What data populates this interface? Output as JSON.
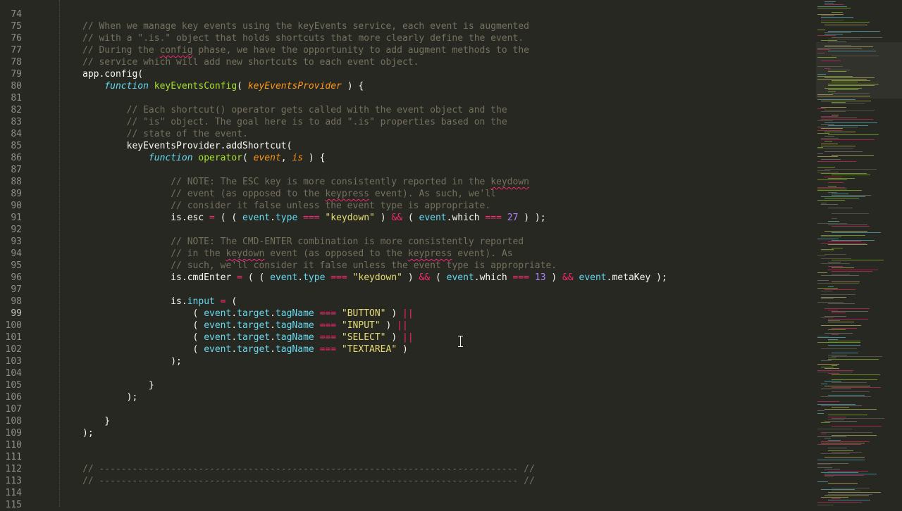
{
  "editor": {
    "active_line": 99,
    "lines": [
      {
        "n": 74,
        "segs": []
      },
      {
        "n": 75,
        "segs": [
          {
            "t": "// When we manage key events using the keyEvents service, each event is augmented",
            "c": "c-comment"
          }
        ]
      },
      {
        "n": 76,
        "segs": [
          {
            "t": "// with a \".is.\" object that holds shortcuts that more clearly define the event.",
            "c": "c-comment"
          }
        ]
      },
      {
        "n": 77,
        "segs": [
          {
            "t": "// During the ",
            "c": "c-comment"
          },
          {
            "t": "config",
            "c": "c-comment squig"
          },
          {
            "t": " phase, we have the opportunity to add augment methods to the",
            "c": "c-comment"
          }
        ]
      },
      {
        "n": 78,
        "segs": [
          {
            "t": "// service which will add new shortcuts to each event object.",
            "c": "c-comment"
          }
        ]
      },
      {
        "n": 79,
        "segs": [
          {
            "t": "app.config(",
            "c": "c-plain"
          }
        ]
      },
      {
        "n": 80,
        "segs": [
          {
            "t": "    ",
            "c": "c-plain"
          },
          {
            "t": "function",
            "c": "c-kw"
          },
          {
            "t": " ",
            "c": "c-plain"
          },
          {
            "t": "keyEventsConfig",
            "c": "c-fn"
          },
          {
            "t": "( ",
            "c": "c-plain"
          },
          {
            "t": "keyEventsProvider",
            "c": "c-param"
          },
          {
            "t": " ) {",
            "c": "c-plain"
          }
        ]
      },
      {
        "n": 81,
        "segs": []
      },
      {
        "n": 82,
        "segs": [
          {
            "t": "        // Each shortcut() operator gets called with the event object and the",
            "c": "c-comment"
          }
        ]
      },
      {
        "n": 83,
        "segs": [
          {
            "t": "        // \"is\" object. The goal here is to add \".is\" properties based on the",
            "c": "c-comment"
          }
        ]
      },
      {
        "n": 84,
        "segs": [
          {
            "t": "        // state of the event.",
            "c": "c-comment"
          }
        ]
      },
      {
        "n": 85,
        "segs": [
          {
            "t": "        keyEventsProvider.addShortcut(",
            "c": "c-plain"
          }
        ]
      },
      {
        "n": 86,
        "segs": [
          {
            "t": "            ",
            "c": "c-plain"
          },
          {
            "t": "function",
            "c": "c-kw"
          },
          {
            "t": " ",
            "c": "c-plain"
          },
          {
            "t": "operator",
            "c": "c-fn"
          },
          {
            "t": "( ",
            "c": "c-plain"
          },
          {
            "t": "event",
            "c": "c-param"
          },
          {
            "t": ", ",
            "c": "c-plain"
          },
          {
            "t": "is",
            "c": "c-param"
          },
          {
            "t": " ) {",
            "c": "c-plain"
          }
        ]
      },
      {
        "n": 87,
        "segs": []
      },
      {
        "n": 88,
        "segs": [
          {
            "t": "                // NOTE: The ESC key is more consistently reported in the ",
            "c": "c-comment"
          },
          {
            "t": "keydown",
            "c": "c-comment squig"
          }
        ]
      },
      {
        "n": 89,
        "segs": [
          {
            "t": "                // event (as opposed to the ",
            "c": "c-comment"
          },
          {
            "t": "keypress",
            "c": "c-comment squig"
          },
          {
            "t": " event). As such, we'll",
            "c": "c-comment"
          }
        ]
      },
      {
        "n": 90,
        "segs": [
          {
            "t": "                // consider it false unless the event type is appropriate.",
            "c": "c-comment"
          }
        ]
      },
      {
        "n": 91,
        "segs": [
          {
            "t": "                is.",
            "c": "c-plain"
          },
          {
            "t": "esc",
            "c": "c-plain"
          },
          {
            "t": " = ",
            "c": "c-op"
          },
          {
            "t": "( ( ",
            "c": "c-plain"
          },
          {
            "t": "event",
            "c": "c-prop"
          },
          {
            "t": ".",
            "c": "c-plain"
          },
          {
            "t": "type",
            "c": "c-prop"
          },
          {
            "t": " === ",
            "c": "c-op"
          },
          {
            "t": "\"keydown\"",
            "c": "c-str"
          },
          {
            "t": " ) ",
            "c": "c-plain"
          },
          {
            "t": "&&",
            "c": "c-op"
          },
          {
            "t": " ( ",
            "c": "c-plain"
          },
          {
            "t": "event",
            "c": "c-prop"
          },
          {
            "t": ".which",
            "c": "c-plain"
          },
          {
            "t": " === ",
            "c": "c-op"
          },
          {
            "t": "27",
            "c": "c-num"
          },
          {
            "t": " ) );",
            "c": "c-plain"
          }
        ]
      },
      {
        "n": 92,
        "segs": []
      },
      {
        "n": 93,
        "segs": [
          {
            "t": "                // NOTE: The CMD-ENTER combination is more consistently reported",
            "c": "c-comment"
          }
        ]
      },
      {
        "n": 94,
        "segs": [
          {
            "t": "                // in the ",
            "c": "c-comment"
          },
          {
            "t": "keydown",
            "c": "c-comment squig"
          },
          {
            "t": " event (as opposed to the ",
            "c": "c-comment"
          },
          {
            "t": "keypress",
            "c": "c-comment squig"
          },
          {
            "t": " event). As",
            "c": "c-comment"
          }
        ]
      },
      {
        "n": 95,
        "segs": [
          {
            "t": "                // such, we'll consider it false unless the event type is appropriate.",
            "c": "c-comment"
          }
        ]
      },
      {
        "n": 96,
        "segs": [
          {
            "t": "                is.cmdEnter",
            "c": "c-plain"
          },
          {
            "t": " = ",
            "c": "c-op"
          },
          {
            "t": "( ( ",
            "c": "c-plain"
          },
          {
            "t": "event",
            "c": "c-prop"
          },
          {
            "t": ".",
            "c": "c-plain"
          },
          {
            "t": "type",
            "c": "c-prop"
          },
          {
            "t": " === ",
            "c": "c-op"
          },
          {
            "t": "\"keydown\"",
            "c": "c-str"
          },
          {
            "t": " ) ",
            "c": "c-plain"
          },
          {
            "t": "&&",
            "c": "c-op"
          },
          {
            "t": " ( ",
            "c": "c-plain"
          },
          {
            "t": "event",
            "c": "c-prop"
          },
          {
            "t": ".which",
            "c": "c-plain"
          },
          {
            "t": " === ",
            "c": "c-op"
          },
          {
            "t": "13",
            "c": "c-num"
          },
          {
            "t": " ) ",
            "c": "c-plain"
          },
          {
            "t": "&&",
            "c": "c-op"
          },
          {
            "t": " ",
            "c": "c-plain"
          },
          {
            "t": "event",
            "c": "c-prop"
          },
          {
            "t": ".metaKey );",
            "c": "c-plain"
          }
        ]
      },
      {
        "n": 97,
        "segs": []
      },
      {
        "n": 98,
        "segs": [
          {
            "t": "                is.",
            "c": "c-plain"
          },
          {
            "t": "input",
            "c": "c-prop"
          },
          {
            "t": " = ",
            "c": "c-op"
          },
          {
            "t": "(",
            "c": "c-plain"
          }
        ]
      },
      {
        "n": 99,
        "segs": [
          {
            "t": "                    ( ",
            "c": "c-plain"
          },
          {
            "t": "event",
            "c": "c-prop"
          },
          {
            "t": ".",
            "c": "c-plain"
          },
          {
            "t": "target",
            "c": "c-prop"
          },
          {
            "t": ".",
            "c": "c-plain"
          },
          {
            "t": "tagName",
            "c": "c-prop"
          },
          {
            "t": " === ",
            "c": "c-op"
          },
          {
            "t": "\"BUTTON\"",
            "c": "c-str"
          },
          {
            "t": " ) ",
            "c": "c-plain"
          },
          {
            "t": "||",
            "c": "c-op"
          }
        ]
      },
      {
        "n": 100,
        "segs": [
          {
            "t": "                    ( ",
            "c": "c-plain"
          },
          {
            "t": "event",
            "c": "c-prop"
          },
          {
            "t": ".",
            "c": "c-plain"
          },
          {
            "t": "target",
            "c": "c-prop"
          },
          {
            "t": ".",
            "c": "c-plain"
          },
          {
            "t": "tagName",
            "c": "c-prop"
          },
          {
            "t": " === ",
            "c": "c-op"
          },
          {
            "t": "\"INPUT\"",
            "c": "c-str"
          },
          {
            "t": " ) ",
            "c": "c-plain"
          },
          {
            "t": "||",
            "c": "c-op"
          }
        ]
      },
      {
        "n": 101,
        "segs": [
          {
            "t": "                    ( ",
            "c": "c-plain"
          },
          {
            "t": "event",
            "c": "c-prop"
          },
          {
            "t": ".",
            "c": "c-plain"
          },
          {
            "t": "target",
            "c": "c-prop"
          },
          {
            "t": ".",
            "c": "c-plain"
          },
          {
            "t": "tagName",
            "c": "c-prop"
          },
          {
            "t": " === ",
            "c": "c-op"
          },
          {
            "t": "\"SELECT\"",
            "c": "c-str"
          },
          {
            "t": " ) ",
            "c": "c-plain"
          },
          {
            "t": "||",
            "c": "c-op"
          }
        ]
      },
      {
        "n": 102,
        "segs": [
          {
            "t": "                    ( ",
            "c": "c-plain"
          },
          {
            "t": "event",
            "c": "c-prop"
          },
          {
            "t": ".",
            "c": "c-plain"
          },
          {
            "t": "target",
            "c": "c-prop"
          },
          {
            "t": ".",
            "c": "c-plain"
          },
          {
            "t": "tagName",
            "c": "c-prop"
          },
          {
            "t": " === ",
            "c": "c-op"
          },
          {
            "t": "\"TEXTAREA\"",
            "c": "c-str"
          },
          {
            "t": " )",
            "c": "c-plain"
          }
        ]
      },
      {
        "n": 103,
        "segs": [
          {
            "t": "                );",
            "c": "c-plain"
          }
        ]
      },
      {
        "n": 104,
        "segs": []
      },
      {
        "n": 105,
        "segs": [
          {
            "t": "            }",
            "c": "c-plain"
          }
        ]
      },
      {
        "n": 106,
        "segs": [
          {
            "t": "        );",
            "c": "c-plain"
          }
        ]
      },
      {
        "n": 107,
        "segs": []
      },
      {
        "n": 108,
        "segs": [
          {
            "t": "    }",
            "c": "c-plain"
          }
        ]
      },
      {
        "n": 109,
        "segs": [
          {
            "t": ");",
            "c": "c-plain"
          }
        ]
      },
      {
        "n": 110,
        "segs": []
      },
      {
        "n": 111,
        "segs": []
      },
      {
        "n": 112,
        "segs": [
          {
            "t": "// ---------------------------------------------------------------------------- //",
            "c": "c-comment"
          }
        ]
      },
      {
        "n": 113,
        "segs": [
          {
            "t": "// ---------------------------------------------------------------------------- //",
            "c": "c-comment"
          }
        ]
      },
      {
        "n": 114,
        "segs": []
      },
      {
        "n": 115,
        "segs": []
      }
    ]
  },
  "theme": {
    "background": "#272822",
    "comment": "#75715e",
    "keyword": "#66d9ef",
    "function": "#a6e22e",
    "string": "#e6db74",
    "number": "#ae81ff",
    "operator": "#f92672",
    "parameter": "#fd971f"
  }
}
